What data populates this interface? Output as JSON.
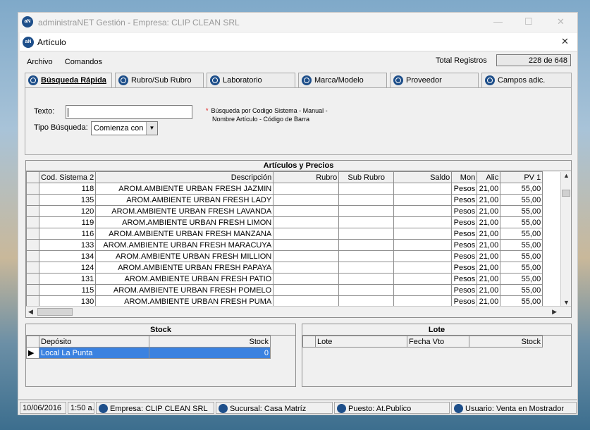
{
  "outer_window": {
    "title": "administraNET Gestión - Empresa: CLIP CLEAN SRL"
  },
  "window": {
    "title": "Artículo"
  },
  "menu": [
    "Archivo",
    "Comandos"
  ],
  "total": {
    "label": "Total Registros",
    "value": "228 de 648"
  },
  "tabs": [
    "Búsqueda Rápida",
    "Rubro/Sub Rubro",
    "Laboratorio",
    "Marca/Modelo",
    "Proveedor",
    "Campos adic."
  ],
  "search": {
    "texto_label": "Texto:",
    "texto_value": "",
    "tipo_label": "Tipo Búsqueda:",
    "tipo_value": "Comienza con",
    "hint_line1": "Búsqueda por Codigo Sistema - Manual -",
    "hint_line2": "Nombre Artículo - Código de Barra"
  },
  "grid": {
    "title": "Artículos y Precios",
    "columns": [
      "Cod. Sistema 2",
      "Descripción",
      "Rubro",
      "Sub Rubro",
      "Saldo",
      "Mon",
      "Alic",
      "PV 1"
    ],
    "rows": [
      [
        "118",
        "AROM.AMBIENTE URBAN FRESH JAZMIN",
        "",
        "",
        "",
        "Pesos",
        "21,00",
        "55,00"
      ],
      [
        "135",
        "AROM.AMBIENTE URBAN FRESH LADY",
        "",
        "",
        "",
        "Pesos",
        "21,00",
        "55,00"
      ],
      [
        "120",
        "AROM.AMBIENTE URBAN FRESH LAVANDA",
        "",
        "",
        "",
        "Pesos",
        "21,00",
        "55,00"
      ],
      [
        "119",
        "AROM.AMBIENTE URBAN FRESH LIMON",
        "",
        "",
        "",
        "Pesos",
        "21,00",
        "55,00"
      ],
      [
        "116",
        "AROM.AMBIENTE URBAN FRESH MANZANA",
        "",
        "",
        "",
        "Pesos",
        "21,00",
        "55,00"
      ],
      [
        "133",
        "AROM.AMBIENTE URBAN FRESH MARACUYA",
        "",
        "",
        "",
        "Pesos",
        "21,00",
        "55,00"
      ],
      [
        "134",
        "AROM.AMBIENTE URBAN FRESH MILLION",
        "",
        "",
        "",
        "Pesos",
        "21,00",
        "55,00"
      ],
      [
        "124",
        "AROM.AMBIENTE URBAN FRESH PAPAYA",
        "",
        "",
        "",
        "Pesos",
        "21,00",
        "55,00"
      ],
      [
        "131",
        "AROM.AMBIENTE URBAN FRESH PATIO",
        "",
        "",
        "",
        "Pesos",
        "21,00",
        "55,00"
      ],
      [
        "115",
        "AROM.AMBIENTE URBAN FRESH POMELO",
        "",
        "",
        "",
        "Pesos",
        "21,00",
        "55,00"
      ],
      [
        "130",
        "AROM.AMBIENTE URBAN FRESH PUMA",
        "",
        "",
        "",
        "Pesos",
        "21,00",
        "55,00"
      ]
    ]
  },
  "stock": {
    "title": "Stock",
    "columns": [
      "Depósito",
      "Stock"
    ],
    "rows": [
      [
        "Local La Punta",
        "0"
      ]
    ]
  },
  "lote": {
    "title": "Lote",
    "columns": [
      "Lote",
      "Fecha Vto",
      "Stock"
    ]
  },
  "status": {
    "date": "10/06/2016",
    "time": "1:50 a.",
    "empresa": "Empresa: CLIP CLEAN SRL",
    "sucursal": "Sucursal: Casa Matríz",
    "puesto": "Puesto: At.Publico",
    "usuario": "Usuario: Venta en Mostrador"
  }
}
